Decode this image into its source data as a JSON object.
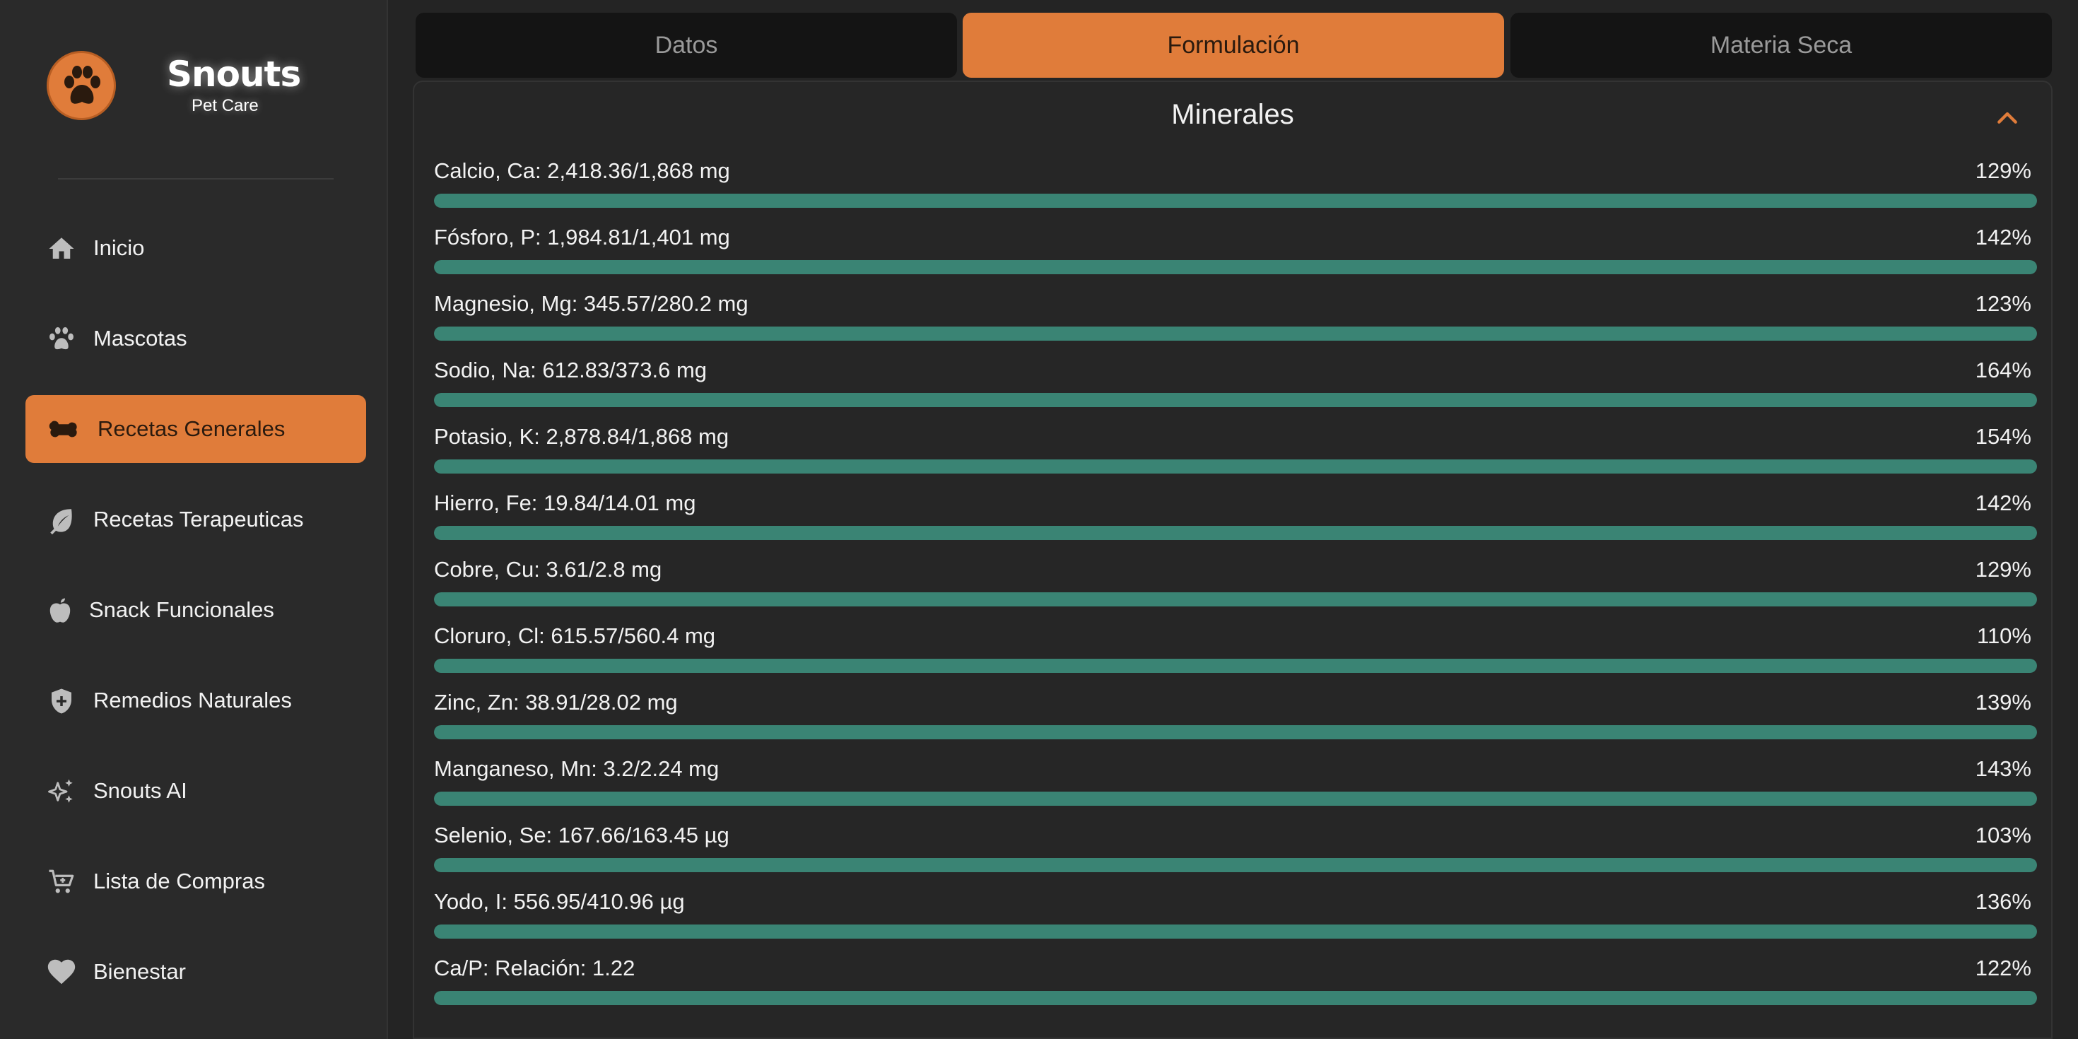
{
  "brand": {
    "name": "Snouts",
    "subtitle": "Pet Care"
  },
  "colors": {
    "accent": "#e07c3a",
    "bar": "#3a8474",
    "background": "#242424",
    "sidebar": "#2a2a2a"
  },
  "sidebar": {
    "items": [
      {
        "label": "Inicio",
        "icon": "home-icon",
        "active": false
      },
      {
        "label": "Mascotas",
        "icon": "paw-icon",
        "active": false
      },
      {
        "label": "Recetas Generales",
        "icon": "bone-icon",
        "active": true
      },
      {
        "label": "Recetas Terapeuticas",
        "icon": "leaf-icon",
        "active": false
      },
      {
        "label": "Snack Funcionales",
        "icon": "apple-icon",
        "active": false
      },
      {
        "label": "Remedios Naturales",
        "icon": "medical-shield-icon",
        "active": false
      },
      {
        "label": "Snouts AI",
        "icon": "sparkles-icon",
        "active": false
      },
      {
        "label": "Lista de Compras",
        "icon": "cart-icon",
        "active": false
      },
      {
        "label": "Bienestar",
        "icon": "heart-icon",
        "active": false
      }
    ]
  },
  "tabs": [
    {
      "label": "Datos",
      "active": false
    },
    {
      "label": "Formulación",
      "active": true
    },
    {
      "label": "Materia Seca",
      "active": false
    }
  ],
  "section": {
    "title": "Minerales",
    "rows": [
      {
        "label": "Calcio, Ca: 2,418.36/1,868 mg",
        "percent": "129%",
        "fill": 1.0
      },
      {
        "label": "Fósforo, P: 1,984.81/1,401 mg",
        "percent": "142%",
        "fill": 1.0
      },
      {
        "label": "Magnesio, Mg: 345.57/280.2 mg",
        "percent": "123%",
        "fill": 1.0
      },
      {
        "label": "Sodio, Na: 612.83/373.6 mg",
        "percent": "164%",
        "fill": 1.0
      },
      {
        "label": "Potasio, K: 2,878.84/1,868 mg",
        "percent": "154%",
        "fill": 1.0
      },
      {
        "label": "Hierro, Fe: 19.84/14.01 mg",
        "percent": "142%",
        "fill": 1.0
      },
      {
        "label": "Cobre, Cu: 3.61/2.8 mg",
        "percent": "129%",
        "fill": 1.0
      },
      {
        "label": "Cloruro, Cl: 615.57/560.4 mg",
        "percent": "110%",
        "fill": 1.0
      },
      {
        "label": "Zinc, Zn: 38.91/28.02 mg",
        "percent": "139%",
        "fill": 1.0
      },
      {
        "label": "Manganeso, Mn: 3.2/2.24 mg",
        "percent": "143%",
        "fill": 1.0
      },
      {
        "label": "Selenio, Se: 167.66/163.45 µg",
        "percent": "103%",
        "fill": 1.0
      },
      {
        "label": "Yodo, I: 556.95/410.96 µg",
        "percent": "136%",
        "fill": 1.0
      },
      {
        "label": "Ca/P: Relación: 1.22",
        "percent": "122%",
        "fill": 1.0
      }
    ]
  }
}
